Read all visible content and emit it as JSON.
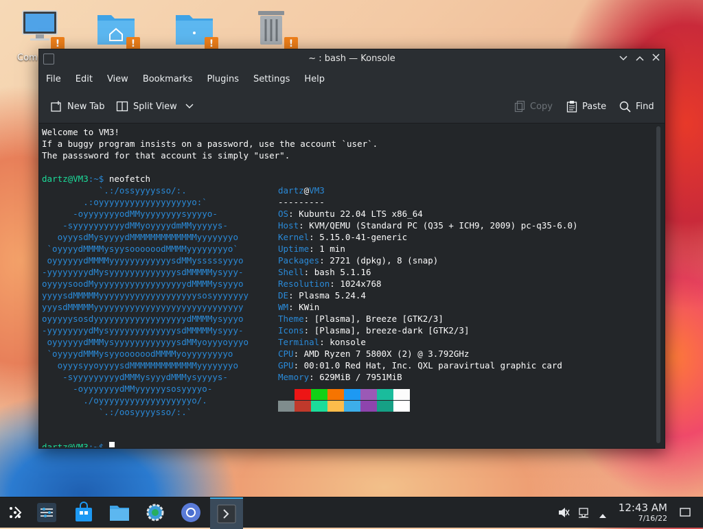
{
  "desktop": {
    "icons": [
      {
        "name": "computer-icon",
        "label": "Com"
      },
      {
        "name": "home-folder-icon"
      },
      {
        "name": "folder-icon"
      },
      {
        "name": "trash-icon"
      }
    ],
    "warn_badge": "!"
  },
  "window": {
    "title": "~ : bash — Konsole",
    "menu": [
      "File",
      "Edit",
      "View",
      "Bookmarks",
      "Plugins",
      "Settings",
      "Help"
    ],
    "toolbar": {
      "new_tab": "New Tab",
      "split_view": "Split View",
      "copy": "Copy",
      "paste": "Paste",
      "find": "Find"
    }
  },
  "terminal": {
    "welcome": [
      "Welcome to VM3!",
      "If a buggy program insists on a password, use the account `user`.",
      "The passsword for that account is simply \"user\"."
    ],
    "prompt_user": "dartz@VM3",
    "prompt_path": ":~$ ",
    "command": "neofetch",
    "logo": [
      "           `.:/ossyyyysso/:.",
      "        .:oyyyyyyyyyyyyyyyyyyo:`",
      "      -oyyyyyyyodMMyyyyyyyysyyyyo-",
      "    -syyyyyyyyyydMMyoyyyydmMMyyyyys-",
      "   oyyysdMysyyyydMMMMMMMMMMMMMyyyyyyyo",
      " `oyyyydMMMMysyysoooooodMMMMyyyyyyyyo`",
      " oyyyyyydMMMMyyyyyyyyyyyysdMMysssssyyyo",
      "-yyyyyyyydMysyyyyyyyyyyyyysdMMMMMysyyy-",
      "oyyyysoodMyyyyyyyyyyyyyyyyyydMMMMysyyyo",
      "yyyysdMMMMMyyyyyyyyyyyyyyyyyyysosyyyyyyy",
      "yyysdMMMMMyyyyyyyyyyyyyyyyyyyyyyyyyyyyy",
      "oyyyyysosdyyyyyyyyyyyyyyyyyydMMMMysyyyo",
      "-yyyyyyyydMysyyyyyyyyyyyyysdMMMMMysyyy-",
      " oyyyyyydMMMysyyyyyyyyyyyysdMMyoyyyoyyyo",
      " `oyyyydMMMysyyoooooodMMMMyoyyyyyyyyo",
      "   oyyysyyoyyyysdMMMMMMMMMMMMMyyyyyyyo",
      "    -syyyyyyyyydMMMysyyydMMMysyyyys-",
      "      -oyyyyyyydMMyyyyyysosyyyyo-",
      "        ./oyyyyyyyyyyyyyyyyyyo/.",
      "           `.:/oosyyyysso/:.`"
    ],
    "info_header_user": "dartz",
    "info_header_at": "@",
    "info_header_host": "VM3",
    "info_separator": "---------",
    "info": [
      {
        "key": "OS",
        "value": "Kubuntu 22.04 LTS x86_64"
      },
      {
        "key": "Host",
        "value": "KVM/QEMU (Standard PC (Q35 + ICH9, 2009) pc-q35-6.0)"
      },
      {
        "key": "Kernel",
        "value": "5.15.0-41-generic"
      },
      {
        "key": "Uptime",
        "value": "1 min"
      },
      {
        "key": "Packages",
        "value": "2721 (dpkg), 8 (snap)"
      },
      {
        "key": "Shell",
        "value": "bash 5.1.16"
      },
      {
        "key": "Resolution",
        "value": "1024x768"
      },
      {
        "key": "DE",
        "value": "Plasma 5.24.4"
      },
      {
        "key": "WM",
        "value": "KWin"
      },
      {
        "key": "Theme",
        "value": "[Plasma], Breeze [GTK2/3]"
      },
      {
        "key": "Icons",
        "value": "[Plasma], breeze-dark [GTK2/3]"
      },
      {
        "key": "Terminal",
        "value": "konsole"
      },
      {
        "key": "CPU",
        "value": "AMD Ryzen 7 5800X (2) @ 3.792GHz"
      },
      {
        "key": "GPU",
        "value": "00:01.0 Red Hat, Inc. QXL paravirtual graphic card"
      },
      {
        "key": "Memory",
        "value": "629MiB / 7951MiB"
      }
    ],
    "palette_top": [
      "#232629",
      "#ed1515",
      "#11d116",
      "#f67400",
      "#1d99f3",
      "#9b59b6",
      "#1abc9c",
      "#fcfcfc"
    ],
    "palette_bottom": [
      "#7f8c8d",
      "#c0392b",
      "#1cdc9a",
      "#fdbc4b",
      "#3daee9",
      "#8e44ad",
      "#16a085",
      "#ffffff"
    ]
  },
  "taskbar": {
    "apps": [
      "application-launcher-icon",
      "system-settings-icon",
      "discover-store-icon",
      "file-manager-icon",
      "settings-gear-icon",
      "chromium-browser-icon",
      "konsole-terminal-icon"
    ],
    "time": "12:43 AM",
    "date": "7/16/22"
  }
}
